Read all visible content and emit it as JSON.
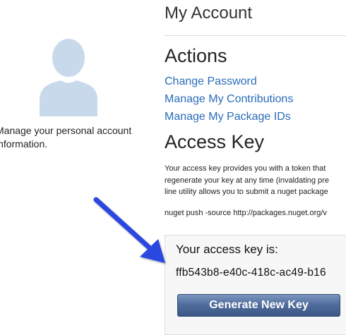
{
  "header": {
    "title": "My Account"
  },
  "left_panel": {
    "avatar_icon": "user-silhouette-icon",
    "description_lines": [
      "Manage your personal account",
      "information."
    ]
  },
  "actions": {
    "heading": "Actions",
    "links": [
      {
        "label": "Change Password"
      },
      {
        "label": "Manage My Contributions"
      },
      {
        "label": "Manage My Package IDs"
      }
    ]
  },
  "access_key": {
    "heading": "Access Key",
    "description_lines": [
      "Your access key provides you with a token that",
      "regenerate your key at any time (invaldating pre",
      "line utility allows you to submit a nuget package"
    ],
    "command": "nuget push -source http://packages.nuget.org/v",
    "box_label": "Your access key is:",
    "key_value": "ffb543b8-e40c-418c-ac49-b16",
    "generate_button_label": "Generate New Key"
  },
  "annotation": {
    "arrow_icon": "pointer-arrow-icon",
    "arrow_color": "#2a46e0"
  },
  "colors": {
    "link": "#2a6db8",
    "avatar": "#c9d9ec",
    "button_top": "#7b95bf",
    "button_bottom": "#3c5786"
  }
}
